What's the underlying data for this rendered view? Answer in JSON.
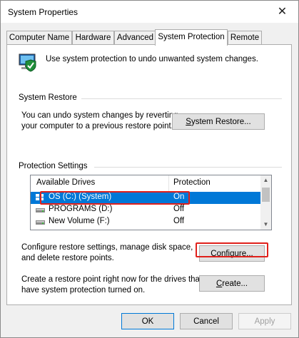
{
  "window": {
    "title": "System Properties",
    "close": "✕"
  },
  "tabs": [
    "Computer Name",
    "Hardware",
    "Advanced",
    "System Protection",
    "Remote"
  ],
  "intro": "Use system protection to undo unwanted system changes.",
  "system_restore": {
    "label": "System Restore",
    "desc_line1": "You can undo system changes by reverting",
    "desc_line2": "your computer to a previous restore point.",
    "button_u": "S",
    "button_rest": "ystem Restore..."
  },
  "protection": {
    "label": "Protection Settings",
    "headers": {
      "drives": "Available Drives",
      "protection": "Protection"
    },
    "drives": [
      {
        "name": "OS (C:) (System)",
        "protection": "On",
        "selected": true
      },
      {
        "name": "PROGRAMS (D:)",
        "protection": "Off",
        "selected": false
      },
      {
        "name": "New Volume (F:)",
        "protection": "Off",
        "selected": false
      }
    ]
  },
  "configure": {
    "desc_line1": "Configure restore settings, manage disk space,",
    "desc_line2": "and delete restore points.",
    "button_u": "O",
    "button_rest": "onfigure...",
    "button_display": "Configure..."
  },
  "create": {
    "desc_line1": "Create a restore point right now for the drives that",
    "desc_line2": "have system protection turned on.",
    "button_pre": "",
    "button_u": "C",
    "button_rest": "reate..."
  },
  "footer": {
    "ok": "OK",
    "cancel": "Cancel",
    "apply": "Apply"
  },
  "colors": {
    "selection": "#0078d7",
    "highlight": "#e0201b"
  }
}
